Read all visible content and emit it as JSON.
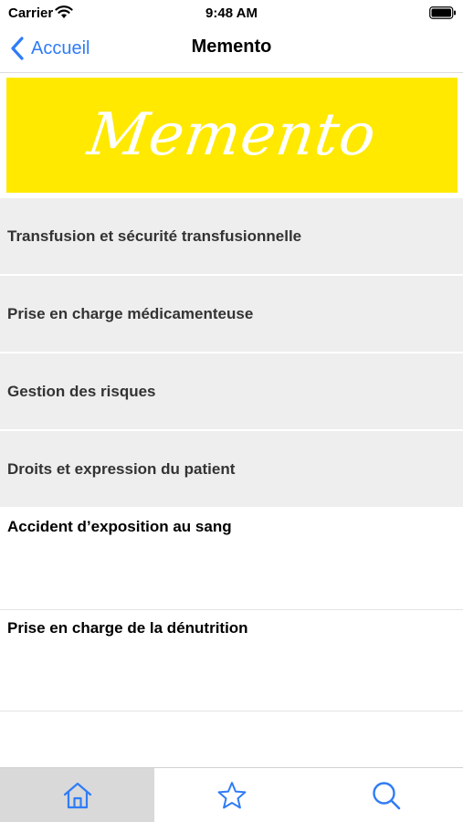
{
  "status_bar": {
    "carrier": "Carrier",
    "time": "9:48 AM"
  },
  "nav": {
    "back_label": "Accueil",
    "title": "Memento"
  },
  "banner": {
    "text": "Memento",
    "background": "#ffe900"
  },
  "list": {
    "gray_items": [
      {
        "label": "Transfusion et sécurité transfusionnelle"
      },
      {
        "label": "Prise en charge médicamenteuse"
      },
      {
        "label": "Gestion des risques"
      },
      {
        "label": "Droits et expression du patient"
      }
    ],
    "white_items": [
      {
        "label": "Accident d’exposition au sang"
      },
      {
        "label": "Prise en charge de la dénutrition"
      }
    ]
  },
  "tab_bar": {
    "tabs": [
      {
        "icon": "home-icon",
        "selected": true
      },
      {
        "icon": "star-icon",
        "selected": false
      },
      {
        "icon": "search-icon",
        "selected": false
      }
    ],
    "accent": "#2f7cf6"
  }
}
